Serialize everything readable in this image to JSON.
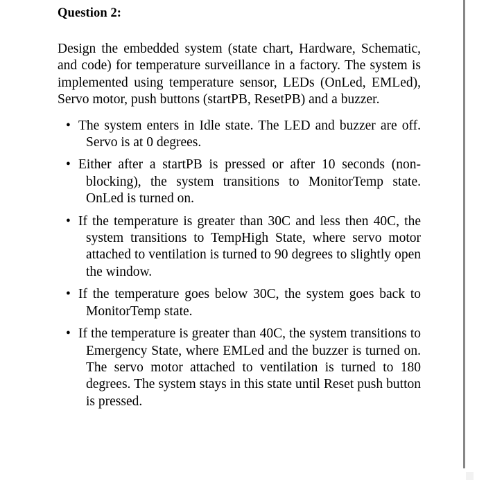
{
  "document": {
    "title": "Question 2:",
    "intro_paragraph": "Design the embedded system (state chart, Hardware, Schematic, and code) for temperature surveillance in a factory. The system is implemented using temperature sensor, LEDs (OnLed, EMLed), Servo motor, push buttons (startPB, ResetPB) and a buzzer.",
    "bullet_marker": "•",
    "requirements": [
      {
        "text": "The system enters in Idle state. The LED and buzzer are off. Servo is at 0 degrees."
      },
      {
        "text": "Either after a startPB is pressed or after 10 seconds (non-blocking), the system transitions to MonitorTemp state. OnLed is turned on."
      },
      {
        "text": "If the temperature is greater than 30C and less then 40C, the system transitions to TempHigh State, where servo motor attached to ventilation is turned to 90 degrees to slightly open the window."
      },
      {
        "text": "If the temperature goes below 30C, the system goes back to MonitorTemp state."
      },
      {
        "text": "If the temperature is greater than 40C, the system transitions to Emergency State, where EMLed and the buzzer is turned on. The servo motor attached to ventilation is turned to 180 degrees. The system stays in this state until Reset push button is pressed."
      }
    ],
    "colors": {
      "page_background": "#ffffff",
      "text": "#000000",
      "divider": "#878787"
    }
  }
}
